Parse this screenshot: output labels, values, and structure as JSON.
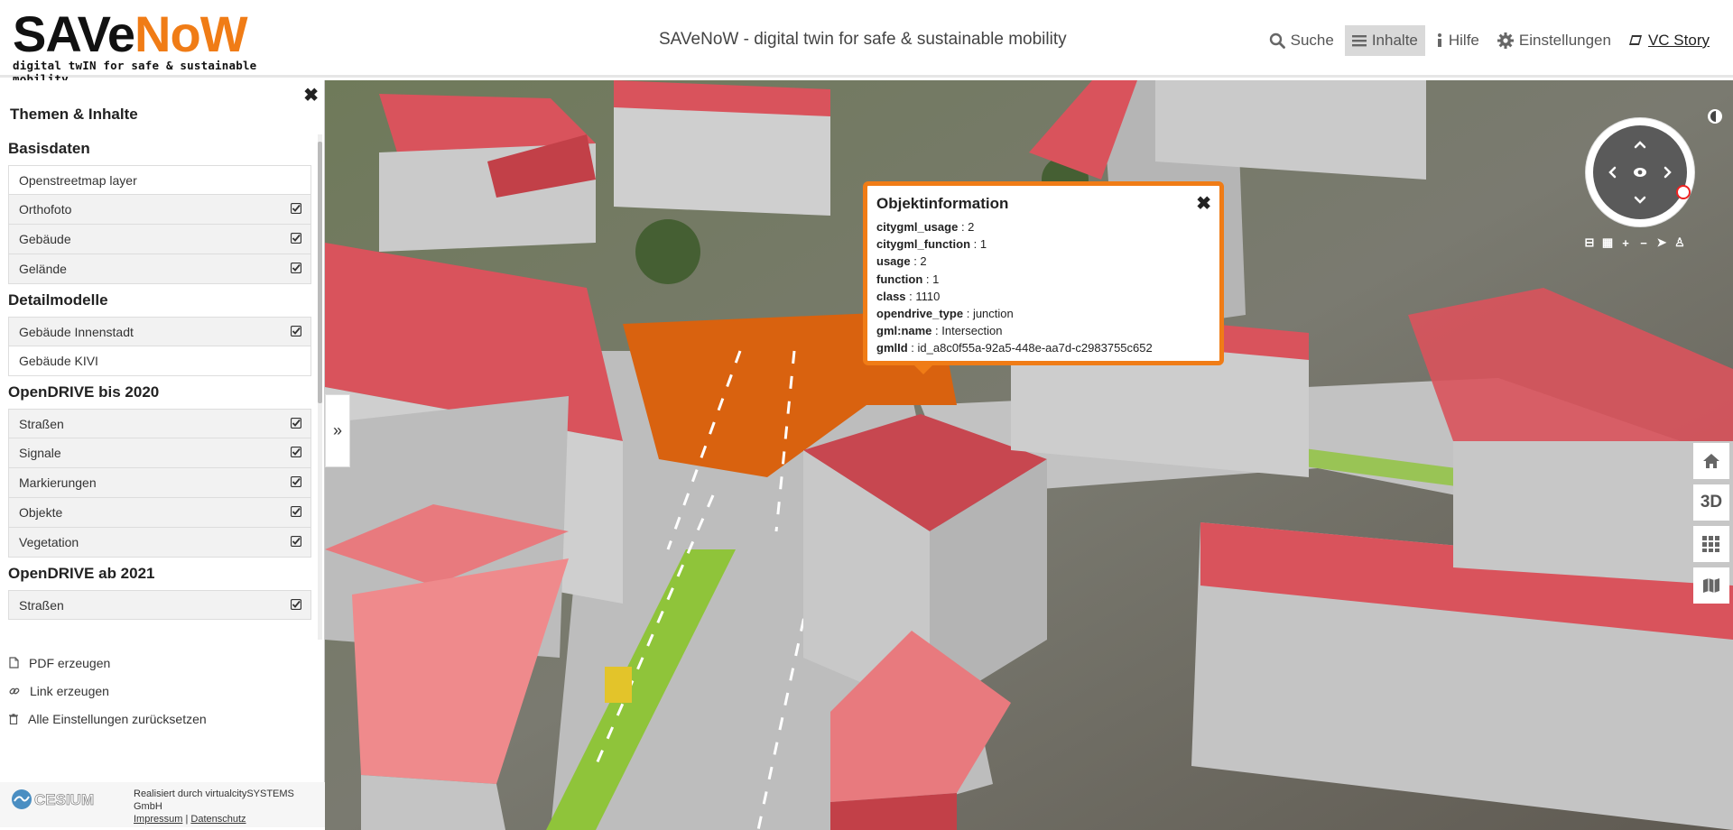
{
  "header": {
    "logo_main_a": "SAVe",
    "logo_main_b": "NoW",
    "logo_tagline": "digital twIN for safe & sustainable mobility",
    "app_title": "SAVeNoW - digital twin for safe & sustainable mobility",
    "menu": [
      {
        "label": "Suche",
        "icon": "search-icon"
      },
      {
        "label": "Inhalte",
        "icon": "list-icon",
        "active": true
      },
      {
        "label": "Hilfe",
        "icon": "info-icon"
      },
      {
        "label": "Einstellungen",
        "icon": "gear-icon"
      },
      {
        "label": "VC Story",
        "icon": "book-icon"
      }
    ]
  },
  "sidebar": {
    "title": "Themen & Inhalte",
    "groups": [
      {
        "title": "Basisdaten",
        "items": [
          {
            "label": "Openstreetmap layer",
            "checked": false
          },
          {
            "label": "Orthofoto",
            "checked": true
          },
          {
            "label": "Gebäude",
            "checked": true
          },
          {
            "label": "Gelände",
            "checked": true
          }
        ]
      },
      {
        "title": "Detailmodelle",
        "items": [
          {
            "label": "Gebäude Innenstadt",
            "checked": true
          },
          {
            "label": "Gebäude KIVI",
            "checked": false
          }
        ]
      },
      {
        "title": "OpenDRIVE bis 2020",
        "items": [
          {
            "label": "Straßen",
            "checked": true
          },
          {
            "label": "Signale",
            "checked": true
          },
          {
            "label": "Markierungen",
            "checked": true
          },
          {
            "label": "Objekte",
            "checked": true
          },
          {
            "label": "Vegetation",
            "checked": true
          }
        ]
      },
      {
        "title": "OpenDRIVE ab 2021",
        "items": [
          {
            "label": "Straßen",
            "checked": true
          }
        ]
      }
    ],
    "actions": [
      {
        "label": "PDF erzeugen",
        "icon": "pdf-icon"
      },
      {
        "label": "Link erzeugen",
        "icon": "link-icon"
      },
      {
        "label": "Alle Einstellungen zurücksetzen",
        "icon": "trash-icon"
      }
    ]
  },
  "footer": {
    "cesium_logo": "CESIUM",
    "credit": "Realisiert durch virtualcitySYSTEMS GmbH",
    "impressum": "Impressum",
    "separator": " | ",
    "datenschutz": "Datenschutz"
  },
  "popup": {
    "title": "Objektinformation",
    "rows": [
      {
        "key": "citygml_usage",
        "value": "2"
      },
      {
        "key": "citygml_function",
        "value": "1"
      },
      {
        "key": "usage",
        "value": "2"
      },
      {
        "key": "function",
        "value": "1"
      },
      {
        "key": "class",
        "value": "1110"
      },
      {
        "key": "opendrive_type",
        "value": "junction"
      },
      {
        "key": "gml:name",
        "value": "Intersection"
      },
      {
        "key": "gmlId",
        "value": "id_a8c0f55a-92a5-448e-aa7d-c2983755c652"
      }
    ]
  },
  "map_controls": {
    "buttons": [
      {
        "label": "",
        "icon": "home-icon"
      },
      {
        "label": "3D",
        "icon": ""
      },
      {
        "label": "",
        "icon": "grid-icon"
      },
      {
        "label": "",
        "icon": "map-icon"
      }
    ]
  },
  "colors": {
    "accent": "#f07c16",
    "roof": "#d9535c",
    "junction": "#d9620f",
    "facade": "#c8c8c8"
  }
}
